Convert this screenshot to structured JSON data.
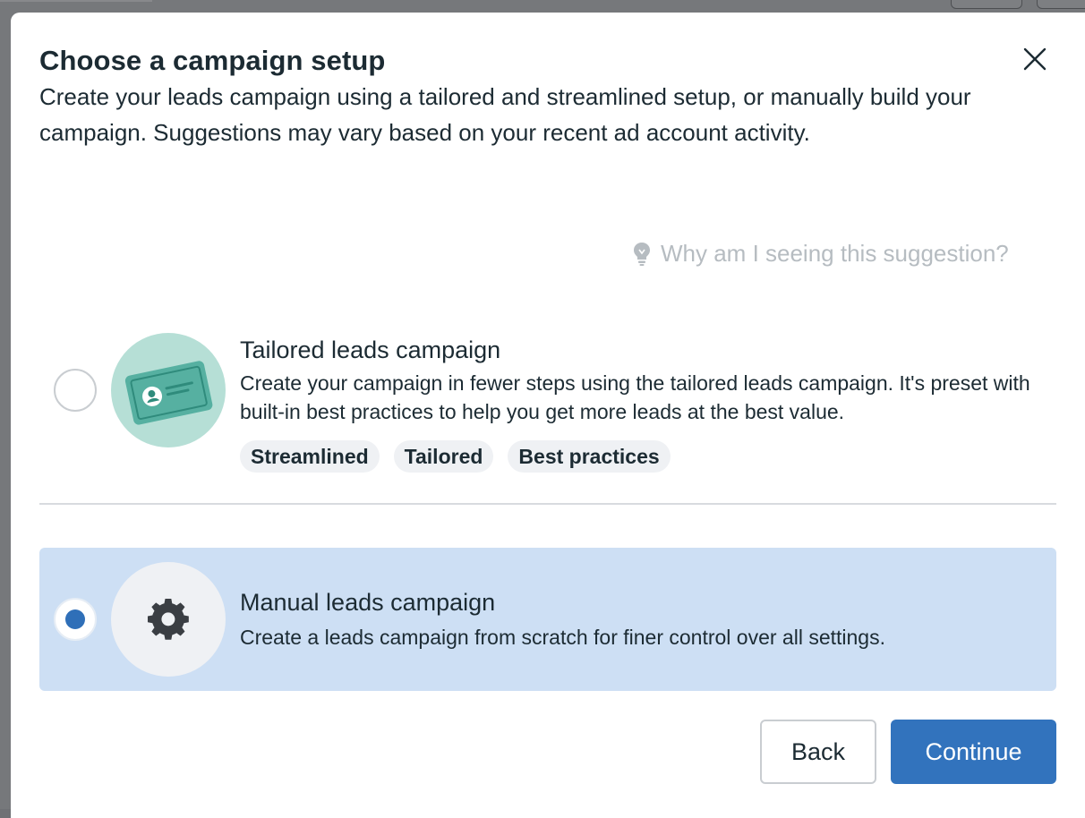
{
  "modal": {
    "title": "Choose a campaign setup",
    "description": "Create your leads campaign using a tailored and streamlined setup, or manually build your campaign. Suggestions may vary based on your recent ad account activity.",
    "close_icon": "close-icon"
  },
  "suggestion_link": {
    "icon": "lightbulb-icon",
    "text": "Why am I seeing this suggestion?"
  },
  "options": [
    {
      "id": "tailored",
      "title": "Tailored leads campaign",
      "description": "Create your campaign in fewer steps using the tailored leads campaign. It's preset with built-in best practices to help you get more leads at the best value.",
      "selected": false,
      "icon": "id-card-icon",
      "tags": [
        "Streamlined",
        "Tailored",
        "Best practices"
      ]
    },
    {
      "id": "manual",
      "title": "Manual leads campaign",
      "description": "Create a leads campaign from scratch for finer control over all settings.",
      "selected": true,
      "icon": "gear-icon"
    }
  ],
  "buttons": {
    "back": "Back",
    "continue": "Continue"
  },
  "colors": {
    "primary": "#3273bd",
    "selected_bg": "#cddff4",
    "text": "#1c2b33",
    "muted_text": "#b6bcc1"
  }
}
